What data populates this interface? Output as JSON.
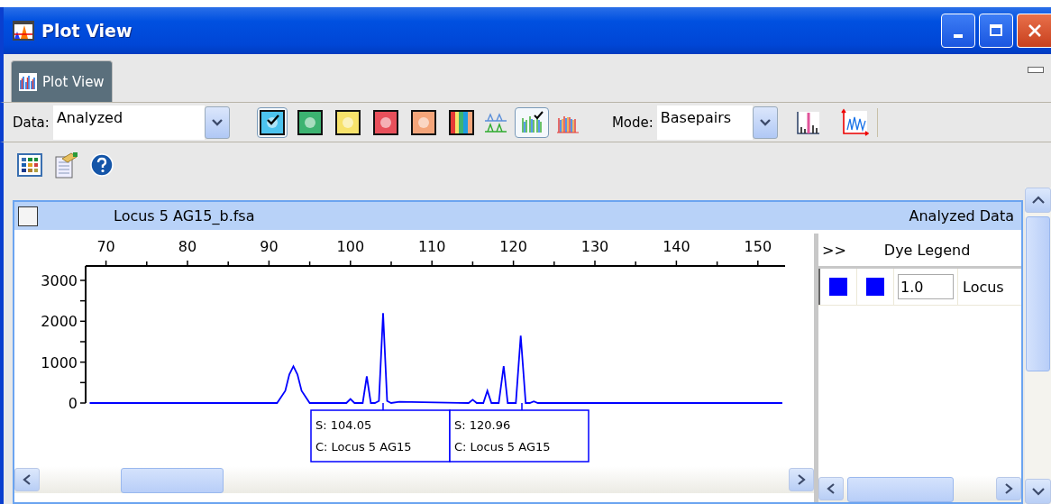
{
  "window": {
    "title": "Plot View"
  },
  "tabs": [
    {
      "label": "Plot View",
      "selected": true
    }
  ],
  "toolbar": {
    "data_label": "Data:",
    "data_value": "Analyzed",
    "color_buttons": [
      {
        "kind": "swatch",
        "color": "#4cc3ee",
        "selected": true
      },
      {
        "kind": "swatch",
        "color": "#3cb371",
        "selected": false
      },
      {
        "kind": "swatch",
        "color": "#f7e26b",
        "selected": false
      },
      {
        "kind": "swatch",
        "color": "#e8505b",
        "selected": false
      },
      {
        "kind": "swatch",
        "color": "#f4a57a",
        "selected": false
      },
      {
        "kind": "rainbow",
        "selected": false
      }
    ],
    "trace_buttons": [
      {
        "kind": "overlay",
        "selected": false
      },
      {
        "kind": "checked",
        "selected": true
      },
      {
        "kind": "multi",
        "selected": false
      }
    ],
    "mode_label": "Mode:",
    "mode_value": "Basepairs"
  },
  "panel": {
    "checked": false,
    "file": "Locus 5 AG15_b.fsa",
    "data_type": "Analyzed Data",
    "chart_data": {
      "type": "line",
      "xlim": [
        67.5,
        153.5
      ],
      "ylim": [
        0,
        3350
      ],
      "xticks": [
        70,
        80,
        90,
        100,
        110,
        120,
        130,
        140,
        150
      ],
      "yticks": [
        0,
        1000,
        2000,
        3000
      ],
      "x": [
        68,
        91,
        92,
        92.5,
        93,
        93.5,
        94,
        95,
        99.5,
        100,
        100.5,
        101.5,
        102,
        102.5,
        103,
        103.5,
        104,
        104.5,
        105,
        106,
        114.5,
        115,
        115.5,
        116.3,
        116.8,
        117.3,
        118.2,
        118.8,
        119.3,
        120.3,
        120.9,
        121.5,
        122,
        122.5,
        123,
        153
      ],
      "series": [
        {
          "color": "#0000ff",
          "values": [
            0,
            0,
            300,
            700,
            900,
            700,
            300,
            0,
            0,
            100,
            0,
            0,
            650,
            0,
            0,
            50,
            2200,
            50,
            0,
            30,
            0,
            80,
            0,
            0,
            300,
            0,
            0,
            900,
            0,
            0,
            1650,
            0,
            0,
            40,
            0,
            0
          ]
        }
      ]
    },
    "peak_labels": [
      {
        "label": "S: 104.05",
        "caption": "C: Locus 5 AG15"
      },
      {
        "label": "S: 120.96",
        "caption": "C: Locus 5 AG15"
      }
    ]
  },
  "legend": {
    "toggle": ">>",
    "title": "Dye Legend",
    "rows": [
      {
        "swatches": [
          {
            "color": "#0000ff"
          },
          {
            "color": "#0000ff"
          }
        ],
        "value": "1.0",
        "label": "Locus"
      }
    ]
  }
}
